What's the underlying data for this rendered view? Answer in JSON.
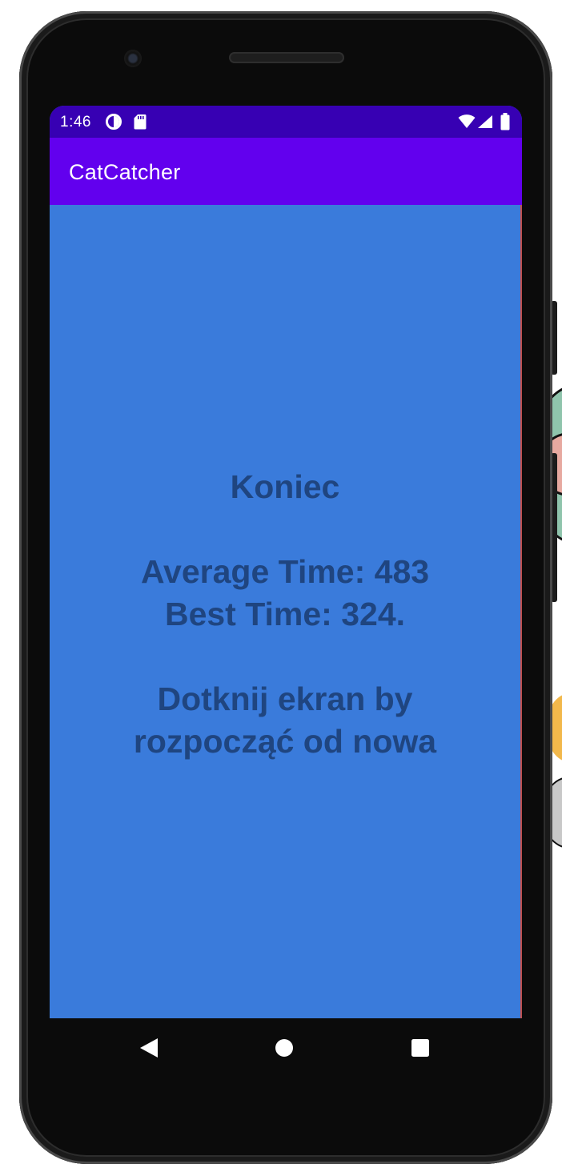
{
  "status_bar": {
    "time": "1:46",
    "left_icons": [
      "data-saver-icon",
      "sd-card-icon"
    ],
    "right_icons": [
      "wifi-icon",
      "signal-icon",
      "battery-icon"
    ]
  },
  "app_bar": {
    "title": "CatCatcher"
  },
  "message": {
    "title": "Koniec",
    "average_time": "Average Time: 483",
    "best_time": "Best Time: 324.",
    "restart_line1": "Dotknij ekran by",
    "restart_line2": "rozpocząć od nowa"
  },
  "nav_bar": {
    "buttons": [
      "back-icon",
      "home-icon",
      "recents-icon"
    ]
  },
  "colors": {
    "status_bar": "#3700b3",
    "app_bar": "#6200ee",
    "content_background": "#3a7bdb",
    "message_text": "#1f4580"
  }
}
